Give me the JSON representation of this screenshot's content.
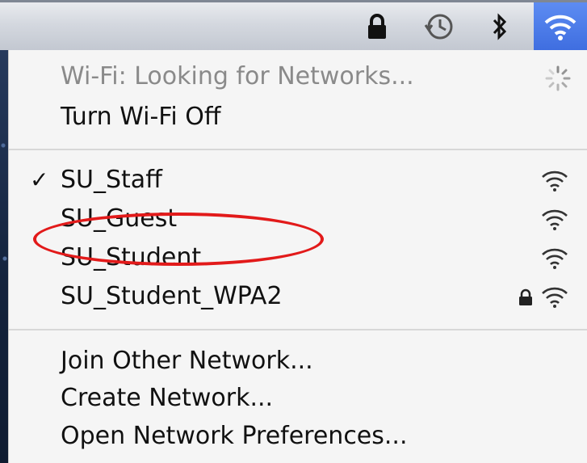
{
  "menubar": {
    "icons": [
      "lock-icon",
      "time-machine-icon",
      "bluetooth-icon",
      "wifi-icon"
    ],
    "wifi_highlight_color": "#4a78ea"
  },
  "wifi_menu": {
    "status": "Wi-Fi: Looking for Networks...",
    "toggle": "Turn Wi-Fi Off",
    "networks": [
      {
        "name": "SU_Staff",
        "connected": true,
        "secured": false
      },
      {
        "name": "SU_Guest",
        "connected": false,
        "secured": false
      },
      {
        "name": "SU_Student",
        "connected": false,
        "secured": false
      },
      {
        "name": "SU_Student_WPA2",
        "connected": false,
        "secured": true
      }
    ],
    "check_mark": "✓",
    "actions": {
      "join_other": "Join Other Network...",
      "create": "Create Network...",
      "open_prefs": "Open Network Preferences..."
    }
  },
  "annotation": {
    "color": "#e21a1a"
  }
}
